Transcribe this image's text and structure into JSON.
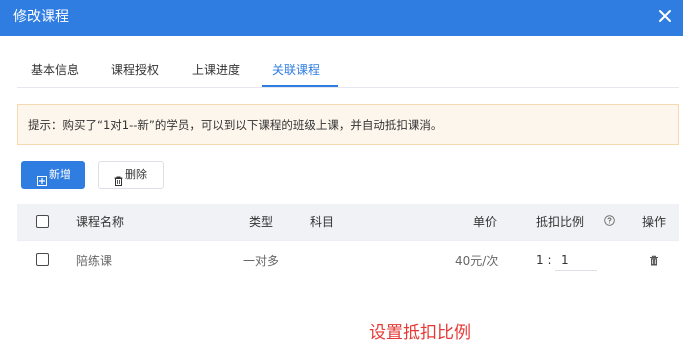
{
  "dialog": {
    "title": "修改课程",
    "close_icon": "close-icon"
  },
  "tabs": [
    {
      "label": "基本信息",
      "active": false
    },
    {
      "label": "课程授权",
      "active": false
    },
    {
      "label": "上课进度",
      "active": false
    },
    {
      "label": "关联课程",
      "active": true
    }
  ],
  "notice": {
    "text": "提示：购买了“1对1--新”的学员，可以到以下课程的班级上课，并自动抵扣课消。"
  },
  "toolbar": {
    "add_label": "新增",
    "add_icon": "add-icon",
    "delete_label": "删除",
    "delete_icon": "delete-icon"
  },
  "table": {
    "headers": {
      "name": "课程名称",
      "type": "类型",
      "subject": "科目",
      "price": "单价",
      "ratio": "抵扣比例",
      "action": "操作"
    },
    "rows": [
      {
        "name": "陪练课",
        "type": "一对多",
        "subject": "",
        "price": "40元/次",
        "ratio_prefix": "1 :",
        "ratio_value": "1"
      }
    ]
  },
  "caption": "设置抵扣比例",
  "colors": {
    "primary": "#2f7de1",
    "notice_bg": "#fdf6ec",
    "header_bg": "#f0f2f5",
    "caption": "#e53935"
  }
}
